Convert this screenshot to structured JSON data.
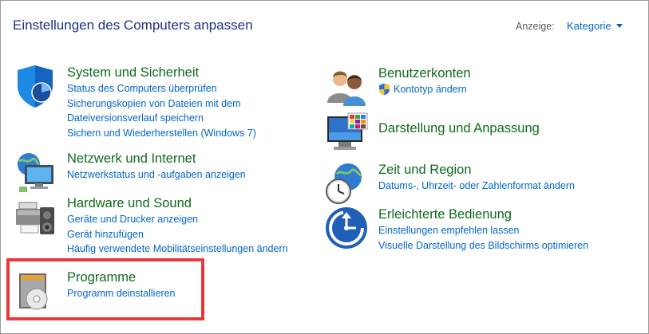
{
  "header": {
    "title": "Einstellungen des Computers anpassen",
    "view_label": "Anzeige:",
    "view_value": "Kategorie"
  },
  "categories": {
    "system": {
      "title": "System und Sicherheit",
      "icon": "security-shield-icon",
      "links": [
        "Status des Computers überprüfen",
        "Sicherungskopien von Dateien mit dem",
        "Dateiversionsverlauf speichern",
        "Sichern und Wiederherstellen (Windows 7)"
      ]
    },
    "network": {
      "title": "Netzwerk und Internet",
      "icon": "network-globe-icon",
      "links": [
        "Netzwerkstatus und -aufgaben anzeigen"
      ]
    },
    "hardware": {
      "title": "Hardware und Sound",
      "icon": "printer-speaker-icon",
      "links": [
        "Geräte und Drucker anzeigen",
        "Gerät hinzufügen",
        "Häufig verwendete Mobilitätseinstellungen ändern"
      ]
    },
    "programs": {
      "title": "Programme",
      "icon": "programs-disc-icon",
      "links": [
        "Programm deinstallieren"
      ]
    },
    "accounts": {
      "title": "Benutzerkonten",
      "icon": "users-icon",
      "links": [
        "Kontotyp ändern"
      ],
      "link_icon": "uac-shield-icon"
    },
    "appearance": {
      "title": "Darstellung und Anpassung",
      "icon": "monitor-palette-icon",
      "links": []
    },
    "clock": {
      "title": "Zeit und Region",
      "icon": "clock-globe-icon",
      "links": [
        "Datums-, Uhrzeit- oder Zahlenformat ändern"
      ]
    },
    "ease": {
      "title": "Erleichterte Bedienung",
      "icon": "ease-of-access-icon",
      "links": [
        "Einstellungen empfehlen lassen",
        "Visuelle Darstellung des Bildschirms optimieren"
      ]
    }
  },
  "colors": {
    "title": "#1e3287",
    "category_title": "#0f6a1c",
    "link": "#0066cc",
    "highlight": "#e8383d"
  }
}
